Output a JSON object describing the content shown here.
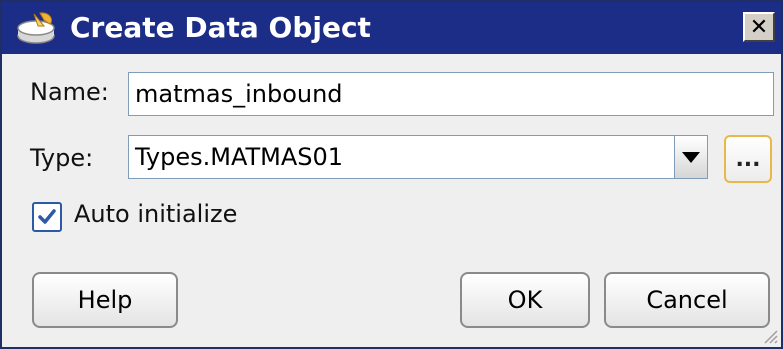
{
  "window": {
    "title": "Create Data Object",
    "icon": "data-object-icon",
    "close_glyph": "✕"
  },
  "form": {
    "name_label": "Name:",
    "name_value": "matmas_inbound",
    "type_label": "Type:",
    "type_value": "Types.MATMAS01",
    "browse_label": "...",
    "auto_init_label": "Auto initialize",
    "auto_init_checked": true
  },
  "buttons": {
    "help": "Help",
    "ok": "OK",
    "cancel": "Cancel"
  },
  "colors": {
    "titlebar": "#1b2d86",
    "browse_border": "#e8b84a",
    "check": "#2b5aa6"
  }
}
